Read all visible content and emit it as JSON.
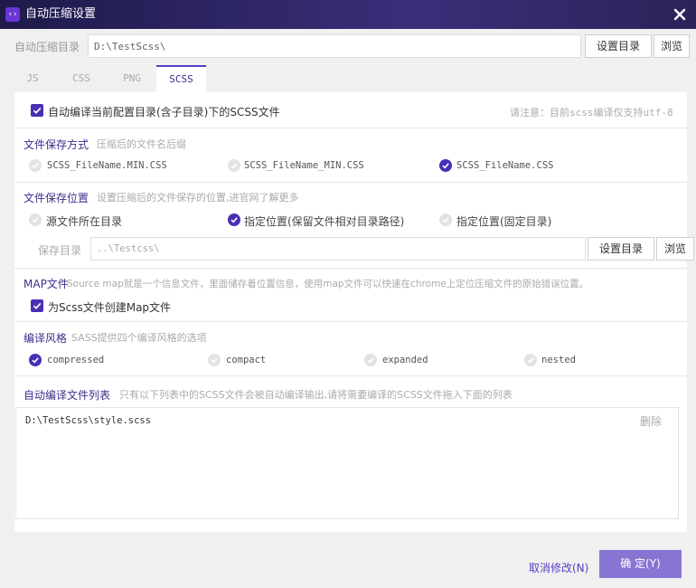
{
  "window": {
    "title": "自动压缩设置",
    "app_icon_glyph": "‹›",
    "icons": {
      "app": "code-icon",
      "close": "close-icon"
    }
  },
  "directory": {
    "label": "自动压缩目录",
    "value": "D:\\TestScss\\",
    "set_dir_button": "设置目录",
    "browse_button": "浏览"
  },
  "tabs": [
    {
      "label": "JS",
      "active": false
    },
    {
      "label": "CSS",
      "active": false
    },
    {
      "label": "PNG",
      "active": false
    },
    {
      "label": "SCSS",
      "active": true
    }
  ],
  "scss": {
    "auto_compile": {
      "label": "自动编译当前配置目录(含子目录)下的SCSS文件",
      "checked": true
    },
    "notice": "请注意：目前scss编译仅支持utf-8",
    "save_name": {
      "title": "文件保存方式",
      "hint": "压缩后的文件名后缀",
      "options": [
        {
          "label": "SCSS_FileName.MIN.CSS",
          "selected": false
        },
        {
          "label": "SCSS_FileName_MIN.CSS",
          "selected": false
        },
        {
          "label": "SCSS_FileName.CSS",
          "selected": true
        }
      ]
    },
    "save_location": {
      "title": "文件保存位置",
      "hint": "设置压缩后的文件保存的位置,进官网了解更多",
      "options": [
        {
          "label": "源文件所在目录",
          "selected": false
        },
        {
          "label": "指定位置(保留文件相对目录路径)",
          "selected": true
        },
        {
          "label": "指定位置(固定目录)",
          "selected": false
        }
      ],
      "save_dir_label": "保存目录",
      "save_dir_value": "..\\Testcss\\",
      "set_dir_button": "设置目录",
      "browse_button": "浏览"
    },
    "map": {
      "title": "MAP文件",
      "hint": "Source map就是一个信息文件，里面储存着位置信息，使用map文件可以快速在chrome上定位压缩文件的原始错误位置。",
      "create_map": {
        "label": "为Scss文件创建Map文件",
        "checked": true
      }
    },
    "style": {
      "title": "编译风格",
      "hint": "SASS提供四个编译风格的选项",
      "options": [
        {
          "label": "compressed",
          "selected": true
        },
        {
          "label": "compact",
          "selected": false
        },
        {
          "label": "expanded",
          "selected": false
        },
        {
          "label": "nested",
          "selected": false
        }
      ]
    },
    "file_list": {
      "title": "自动编译文件列表",
      "hint": "只有以下列表中的SCSS文件会被自动编译输出,请将需要编译的SCSS文件拖入下面的列表",
      "items": [
        "D:\\TestScss\\style.scss"
      ],
      "delete_label": "删除"
    }
  },
  "footer": {
    "cancel": "取消修改(N)",
    "ok": "确 定(Y)"
  },
  "colors": {
    "accent": "#4a2fb5",
    "title_bar": "#2a2358",
    "ok_button": "#8874d3"
  }
}
